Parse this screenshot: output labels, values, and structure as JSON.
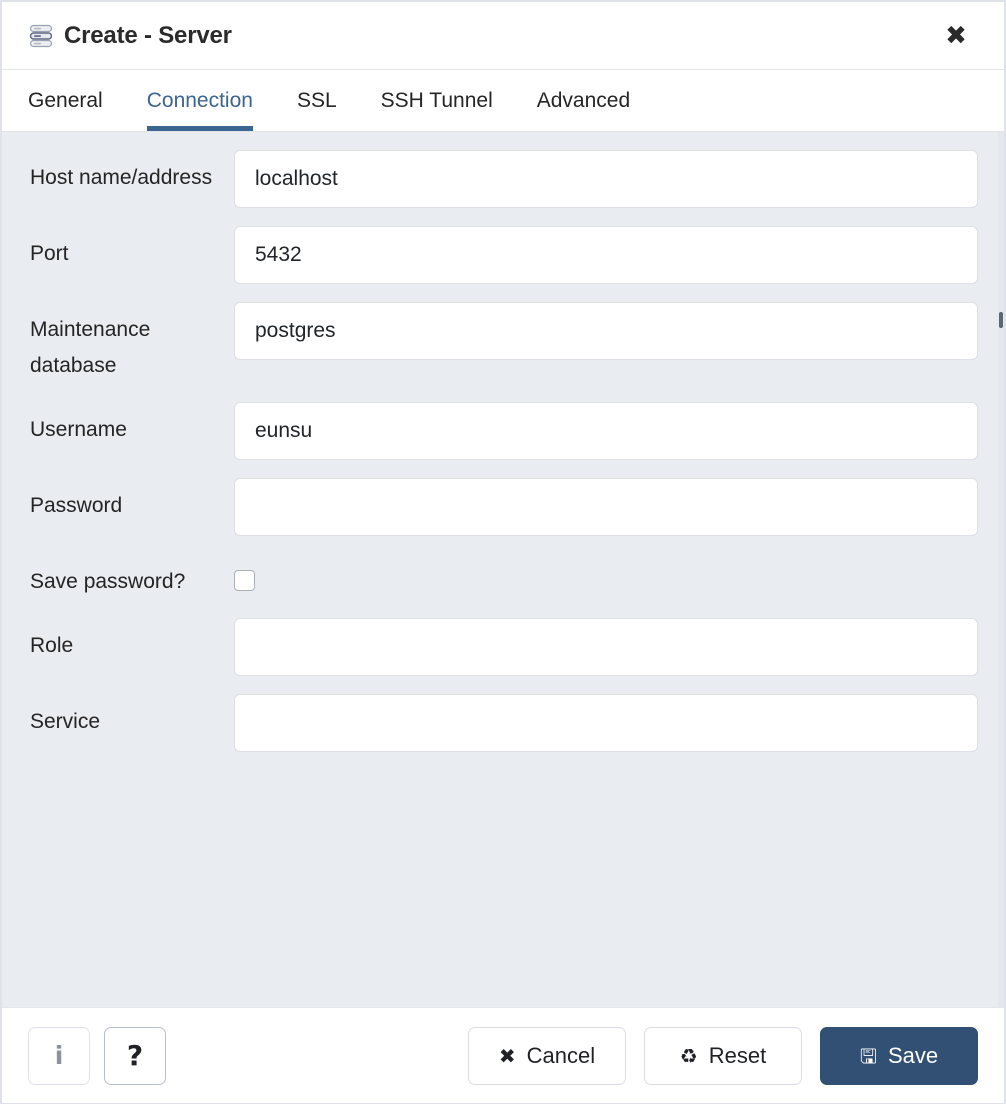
{
  "window": {
    "title": "Create - Server",
    "icon": "server-stack-icon",
    "close_label": "✖",
    "accent_color": "#3c6491",
    "body_background": "#e9edf2",
    "primary_button_color": "#325073"
  },
  "tabs": [
    {
      "label": "General",
      "active": false
    },
    {
      "label": "Connection",
      "active": true
    },
    {
      "label": "SSL",
      "active": false
    },
    {
      "label": "SSH Tunnel",
      "active": false
    },
    {
      "label": "Advanced",
      "active": false
    }
  ],
  "form": {
    "fields": [
      {
        "label": "Host name/address",
        "value": "localhost",
        "placeholder": "",
        "type": "text"
      },
      {
        "label": "Port",
        "value": "5432",
        "placeholder": "",
        "type": "text"
      },
      {
        "label": "Maintenance database",
        "value": "postgres",
        "placeholder": "",
        "type": "text"
      },
      {
        "label": "Username",
        "value": "eunsu",
        "placeholder": "",
        "type": "text"
      },
      {
        "label": "Password",
        "value": "",
        "placeholder": "",
        "type": "password"
      },
      {
        "label": "Save password?",
        "value": "",
        "placeholder": "",
        "type": "checkbox",
        "checked": false
      },
      {
        "label": "Role",
        "value": "",
        "placeholder": "",
        "type": "text"
      },
      {
        "label": "Service",
        "value": "",
        "placeholder": "",
        "type": "text"
      }
    ]
  },
  "footer": {
    "info_glyph": "i",
    "help_glyph": "?",
    "cancel": {
      "label": "Cancel",
      "glyph": "✖"
    },
    "reset": {
      "label": "Reset",
      "glyph": "♻"
    },
    "save": {
      "label": "Save",
      "glyph": "🖫"
    }
  }
}
